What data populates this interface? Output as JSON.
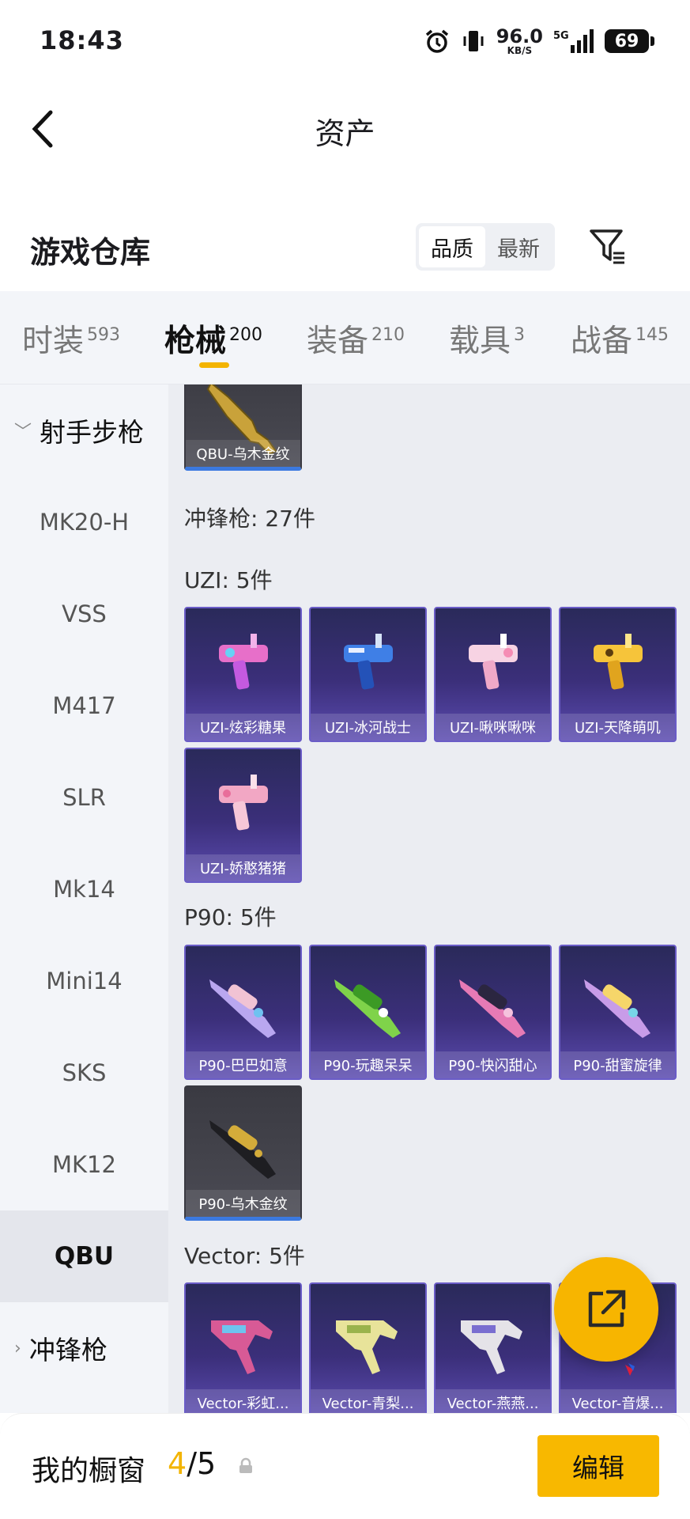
{
  "status_bar": {
    "time": "18:43",
    "net_speed": "96.0",
    "net_unit": "KB/S",
    "network": "5G",
    "battery": "69"
  },
  "nav": {
    "title": "资产"
  },
  "warehouse": {
    "title": "游戏仓库",
    "sort_options": [
      "品质",
      "最新"
    ],
    "sort_selected": "品质"
  },
  "tabs": [
    {
      "label": "时装",
      "count": "593"
    },
    {
      "label": "枪械",
      "count": "200",
      "active": true
    },
    {
      "label": "装备",
      "count": "210"
    },
    {
      "label": "载具",
      "count": "3"
    },
    {
      "label": "战备",
      "count": "145"
    }
  ],
  "sidebar": {
    "group1": "射手步枪",
    "items": [
      "MK20-H",
      "VSS",
      "M417",
      "SLR",
      "Mk14",
      "Mini14",
      "SKS",
      "MK12",
      "QBU"
    ],
    "selected": "QBU",
    "group2": "冲锋枪"
  },
  "content": {
    "top_card": {
      "label": "QBU-乌木金纹"
    },
    "category_header": "冲锋枪: 27件",
    "sections": [
      {
        "title": "UZI: 5件",
        "items": [
          "UZI-炫彩糖果",
          "UZI-冰河战士",
          "UZI-啾咪啾咪",
          "UZI-天降萌叽",
          "UZI-娇憨猪猪"
        ]
      },
      {
        "title": "P90: 5件",
        "items": [
          "P90-巴巴如意",
          "P90-玩趣呆呆",
          "P90-快闪甜心",
          "P90-甜蜜旋律",
          "P90-乌木金纹"
        ]
      },
      {
        "title": "Vector: 5件",
        "items": [
          "Vector-彩虹...",
          "Vector-青梨...",
          "Vector-燕燕...",
          "Vector-音爆..."
        ]
      }
    ]
  },
  "bottom": {
    "label": "我的橱窗",
    "current": "4",
    "total": "/5",
    "edit_label": "编辑"
  },
  "colors": {
    "accent": "#f3b400",
    "card_purple": "#3b2f7a",
    "card_gold": "#44444c"
  }
}
